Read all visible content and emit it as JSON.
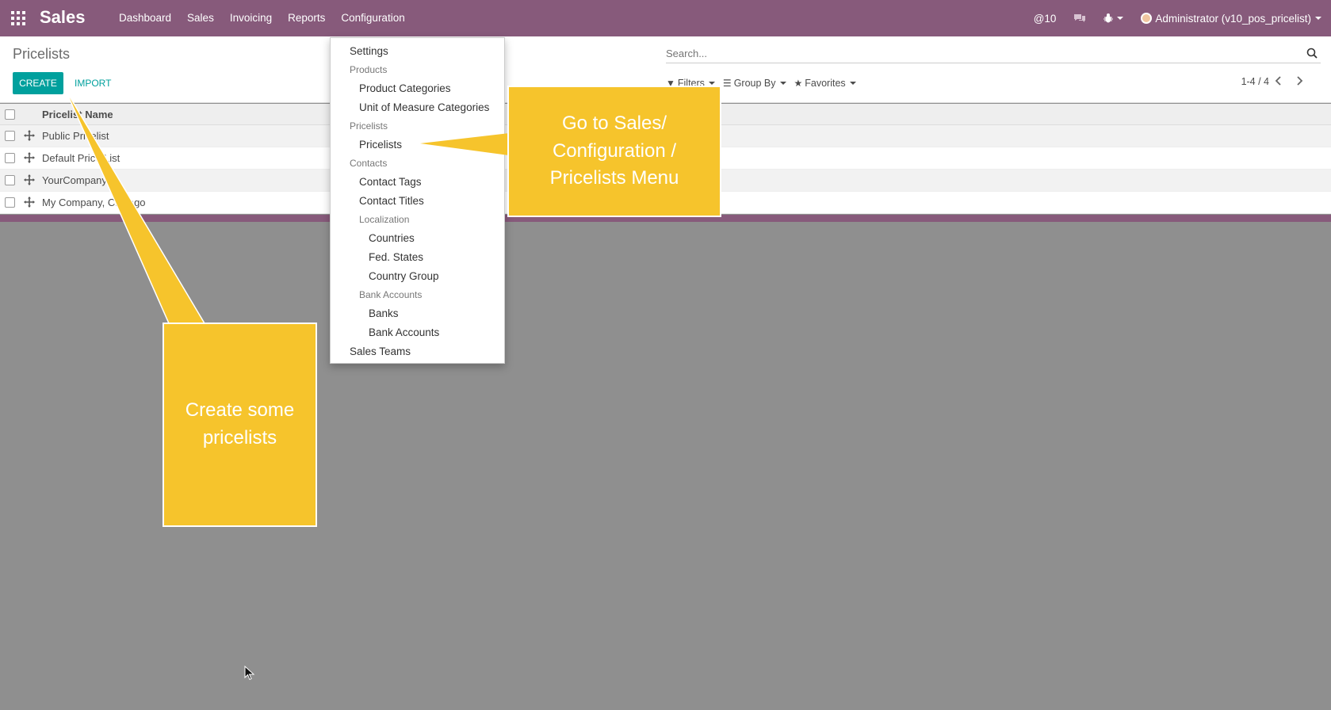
{
  "navbar": {
    "brand": "Sales",
    "menu": [
      "Dashboard",
      "Sales",
      "Invoicing",
      "Reports",
      "Configuration"
    ],
    "mentions": "@10",
    "user": "Administrator (v10_pos_pricelist)",
    "color": "#875a7b"
  },
  "controlpanel": {
    "breadcrumb": "Pricelists",
    "create_label": "CREATE",
    "import_label": "IMPORT",
    "search_placeholder": "Search...",
    "filters_label": "Filters",
    "groupby_label": "Group By",
    "favorites_label": "Favorites",
    "pager": "1-4 / 4"
  },
  "list": {
    "column": "Pricelist Name",
    "rows": [
      "Public Pricelist",
      "Default Price List",
      "YourCompany,",
      "My Company, Chicago"
    ]
  },
  "dropdown": {
    "settings": "Settings",
    "products_head": "Products",
    "product_categories": "Product Categories",
    "uom_categories": "Unit of Measure Categories",
    "pricelists_head": "Pricelists",
    "pricelists": "Pricelists",
    "contacts_head": "Contacts",
    "contact_tags": "Contact Tags",
    "contact_titles": "Contact Titles",
    "localization_head": "Localization",
    "countries": "Countries",
    "fed_states": "Fed. States",
    "country_group": "Country Group",
    "bank_accounts_head": "Bank Accounts",
    "banks": "Banks",
    "bank_accounts": "Bank Accounts",
    "sales_teams": "Sales Teams"
  },
  "callouts": {
    "menu_note_line1": "Go to Sales/",
    "menu_note_line2": "Configuration /",
    "menu_note_line3": "Pricelists Menu",
    "create_note_line1": "Create some",
    "create_note_line2": "pricelists",
    "color": "#f6c42c"
  }
}
